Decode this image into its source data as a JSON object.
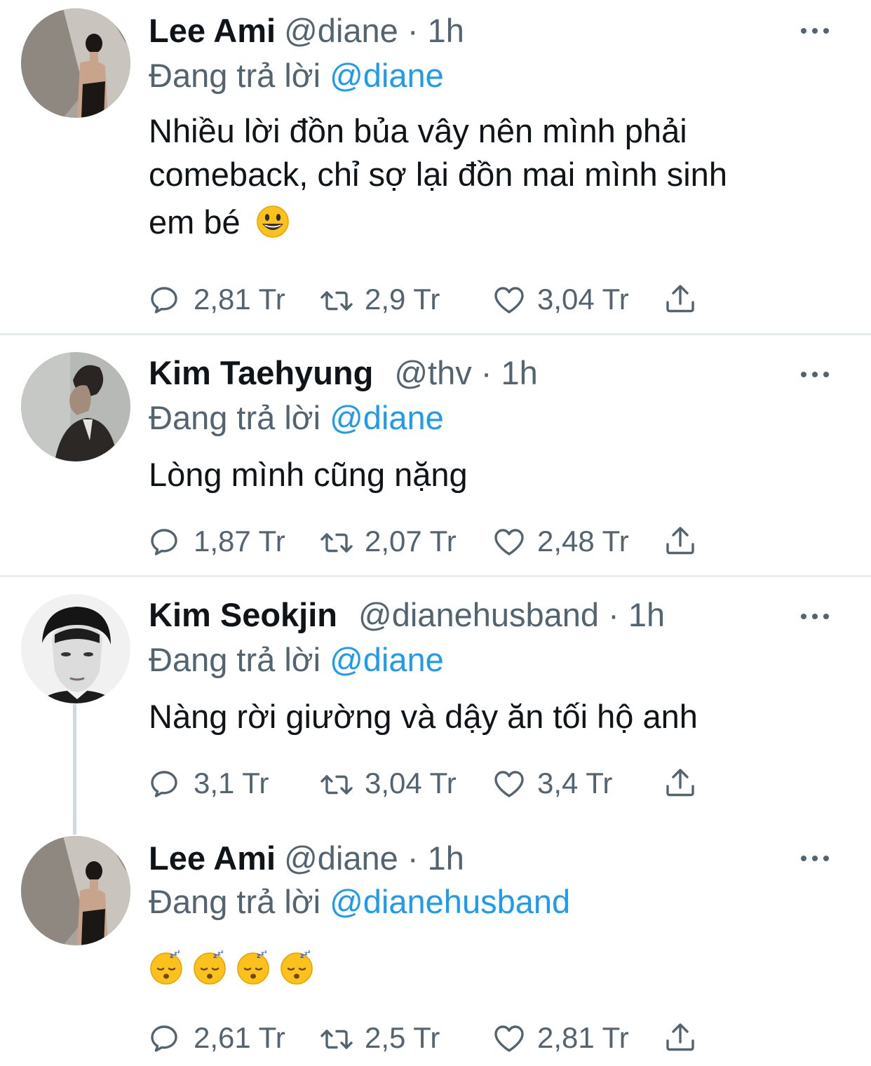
{
  "tweets": [
    {
      "name": "Lee Ami",
      "handle": "@diane · 1h",
      "reply_prefix": "Đang trả lời",
      "reply_to": "@diane",
      "text_line1": "Nhiều lời đồn bủa vây nên mình phải",
      "text_line2": "comeback, chỉ sợ lại đồn mai mình sinh",
      "text_line3": "em bé",
      "text_emoji": "smiley-emoji",
      "reply_count": "2,81 Tr",
      "retweet_count": "2,9 Tr",
      "like_count": "3,04 Tr"
    },
    {
      "name": "Kim Taehyung",
      "handle": "@thv · 1h",
      "reply_prefix": "Đang trả lời",
      "reply_to": "@diane",
      "text": "Lòng mình cũng nặng",
      "reply_count": "1,87 Tr",
      "retweet_count": "2,07 Tr",
      "like_count": "2,48 Tr"
    },
    {
      "name": "Kim Seokjin",
      "handle": "@dianehusband · 1h",
      "reply_prefix": "Đang trả lời",
      "reply_to": "@diane",
      "text": "Nàng rời giường và dậy ăn tối hộ anh",
      "reply_count": "3,1 Tr",
      "retweet_count": "3,04 Tr",
      "like_count": "3,4 Tr"
    },
    {
      "name": "Lee Ami",
      "handle": "@diane · 1h",
      "reply_prefix": "Đang trả lời",
      "reply_to": "@dianehusband",
      "text_emoji": "sleeping-face-emoji x4",
      "reply_count": "2,61 Tr",
      "retweet_count": "2,5 Tr",
      "like_count": "2,81 Tr"
    }
  ],
  "colors": {
    "text": "#0f1419",
    "secondary": "#536471",
    "link": "#1d9bf0",
    "divider": "#e7ecf0"
  },
  "icons": [
    "reply-icon",
    "retweet-icon",
    "like-icon",
    "share-icon",
    "more-icon"
  ]
}
